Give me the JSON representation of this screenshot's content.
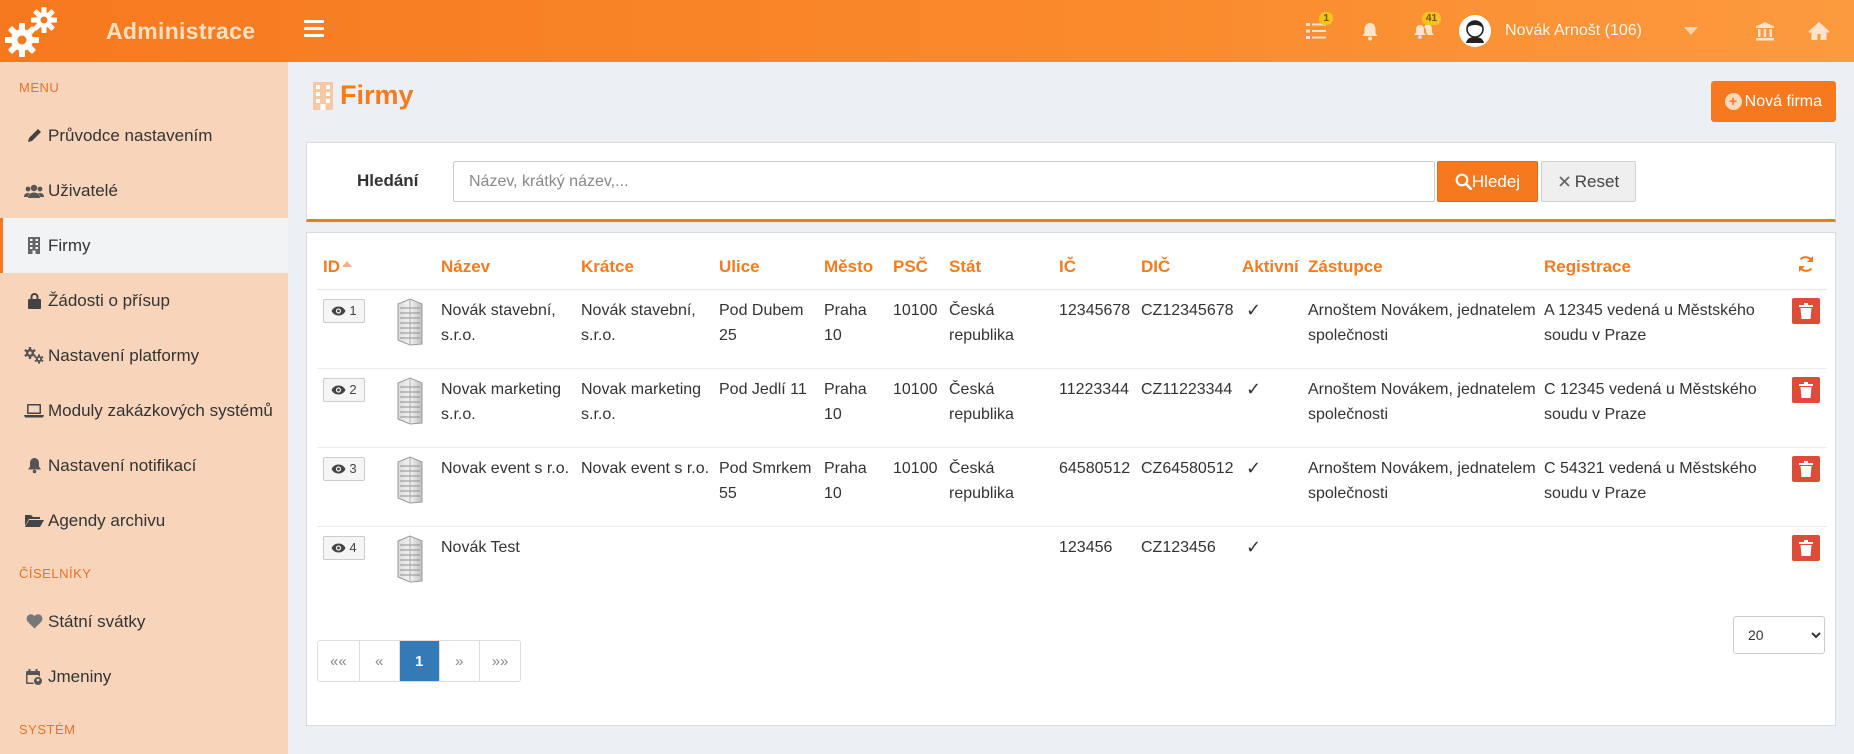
{
  "header": {
    "app_title": "Administrace",
    "badges": {
      "tasks": "1",
      "alerts": "41"
    },
    "user_name": "Novák Arnošt (106)"
  },
  "sidebar": {
    "sections": {
      "menu": "MENU",
      "ciselniky": "ČÍSELNÍKY",
      "system": "SYSTÉM"
    },
    "items": [
      {
        "label": "Průvodce nastavením",
        "icon": "pencil-icon"
      },
      {
        "label": "Uživatelé",
        "icon": "users-icon"
      },
      {
        "label": "Firmy",
        "icon": "building-icon"
      },
      {
        "label": "Žádosti o přísup",
        "icon": "lock-icon"
      },
      {
        "label": "Nastavení platformy",
        "icon": "gears-icon"
      },
      {
        "label": "Moduly zakázkových systémů",
        "icon": "laptop-icon"
      },
      {
        "label": "Nastavení notifikací",
        "icon": "bell-icon"
      },
      {
        "label": "Agendy archivu",
        "icon": "folder-open-icon"
      },
      {
        "label": "Státní svátky",
        "icon": "heart-icon"
      },
      {
        "label": "Jmeniny",
        "icon": "calendar-user-icon"
      }
    ]
  },
  "page": {
    "title": "Firmy",
    "new_button": "Nová firma"
  },
  "search": {
    "label": "Hledání",
    "placeholder": "Název, krátký název,...",
    "search_button": "Hledej",
    "reset_button": "Reset"
  },
  "table": {
    "columns": {
      "id": "ID",
      "nazev": "Název",
      "kratce": "Krátce",
      "ulice": "Ulice",
      "mesto": "Město",
      "psc": "PSČ",
      "stat": "Stát",
      "ic": "IČ",
      "dic": "DIČ",
      "aktivni": "Aktivní",
      "zastupce": "Zástupce",
      "registrace": "Registrace"
    },
    "rows": [
      {
        "id": "1",
        "nazev": "Novák stavební, s.r.o.",
        "kratce": "Novák stavební, s.r.o.",
        "ulice": "Pod Dubem 25",
        "mesto": "Praha 10",
        "psc": "10100",
        "stat": "Česká republika",
        "ic": "12345678",
        "dic": "CZ12345678",
        "aktivni": "✓",
        "zastupce": "Arnoštem Novákem, jednatelem společnosti",
        "registrace": "A 12345 vedená u Městského soudu v Praze"
      },
      {
        "id": "2",
        "nazev": "Novak marketing s.r.o.",
        "kratce": "Novak marketing s.r.o.",
        "ulice": "Pod Jedlí 11",
        "mesto": "Praha 10",
        "psc": "10100",
        "stat": "Česká republika",
        "ic": "11223344",
        "dic": "CZ11223344",
        "aktivni": "✓",
        "zastupce": "Arnoštem Novákem, jednatelem společnosti",
        "registrace": "C 12345 vedená u Městského soudu v Praze"
      },
      {
        "id": "3",
        "nazev": "Novak event s r.o.",
        "kratce": "Novak event s r.o.",
        "ulice": "Pod Smrkem 55",
        "mesto": "Praha 10",
        "psc": "10100",
        "stat": "Česká republika",
        "ic": "64580512",
        "dic": "CZ64580512",
        "aktivni": "✓",
        "zastupce": "Arnoštem Novákem, jednatelem společnosti",
        "registrace": "C 54321 vedená u Městského soudu v Praze"
      },
      {
        "id": "4",
        "nazev": "Novák Test",
        "kratce": "",
        "ulice": "",
        "mesto": "",
        "psc": "",
        "stat": "",
        "ic": "123456",
        "dic": "CZ123456",
        "aktivni": "✓",
        "zastupce": "",
        "registrace": ""
      }
    ]
  },
  "pagination": {
    "first": "««",
    "prev": "«",
    "current": "1",
    "next": "»",
    "last": "»»",
    "page_size": "20"
  },
  "colors": {
    "accent": "#f7791f",
    "sidebar_bg": "#f8d4bb",
    "delete": "#dd4b39",
    "active_page": "#337ab7"
  }
}
